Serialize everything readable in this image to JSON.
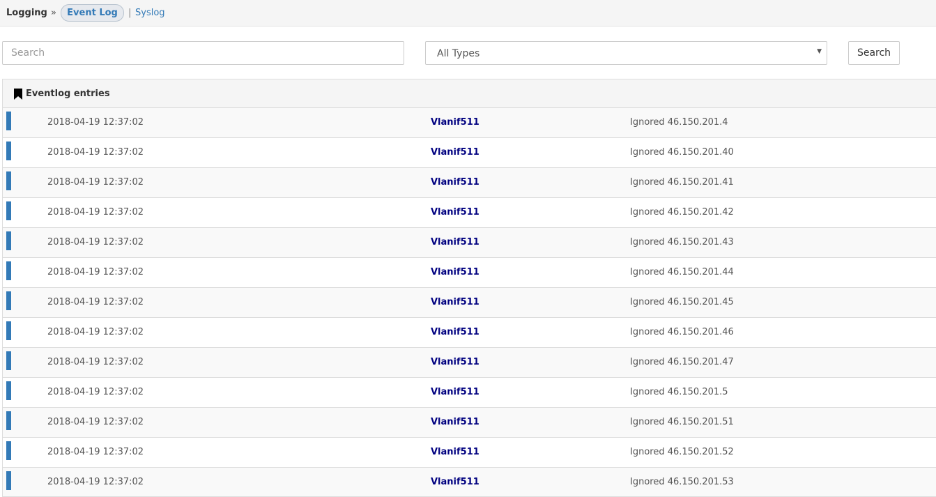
{
  "breadcrumb": {
    "root": "Logging",
    "separator": "»",
    "active": "Event Log",
    "pipe": "|",
    "link": "Syslog"
  },
  "filters": {
    "search_placeholder": "Search",
    "type_selected": "All Types",
    "search_button": "Search"
  },
  "panel": {
    "title": "Eventlog entries",
    "icon": "bookmark-icon"
  },
  "colors": {
    "accent": "#337ab7",
    "interface_link": "#000080"
  },
  "entries": [
    {
      "time": "2018-04-19 12:37:02",
      "interface": "Vlanif511",
      "message": "Ignored 46.150.201.4"
    },
    {
      "time": "2018-04-19 12:37:02",
      "interface": "Vlanif511",
      "message": "Ignored 46.150.201.40"
    },
    {
      "time": "2018-04-19 12:37:02",
      "interface": "Vlanif511",
      "message": "Ignored 46.150.201.41"
    },
    {
      "time": "2018-04-19 12:37:02",
      "interface": "Vlanif511",
      "message": "Ignored 46.150.201.42"
    },
    {
      "time": "2018-04-19 12:37:02",
      "interface": "Vlanif511",
      "message": "Ignored 46.150.201.43"
    },
    {
      "time": "2018-04-19 12:37:02",
      "interface": "Vlanif511",
      "message": "Ignored 46.150.201.44"
    },
    {
      "time": "2018-04-19 12:37:02",
      "interface": "Vlanif511",
      "message": "Ignored 46.150.201.45"
    },
    {
      "time": "2018-04-19 12:37:02",
      "interface": "Vlanif511",
      "message": "Ignored 46.150.201.46"
    },
    {
      "time": "2018-04-19 12:37:02",
      "interface": "Vlanif511",
      "message": "Ignored 46.150.201.47"
    },
    {
      "time": "2018-04-19 12:37:02",
      "interface": "Vlanif511",
      "message": "Ignored 46.150.201.5"
    },
    {
      "time": "2018-04-19 12:37:02",
      "interface": "Vlanif511",
      "message": "Ignored 46.150.201.51"
    },
    {
      "time": "2018-04-19 12:37:02",
      "interface": "Vlanif511",
      "message": "Ignored 46.150.201.52"
    },
    {
      "time": "2018-04-19 12:37:02",
      "interface": "Vlanif511",
      "message": "Ignored 46.150.201.53"
    }
  ]
}
